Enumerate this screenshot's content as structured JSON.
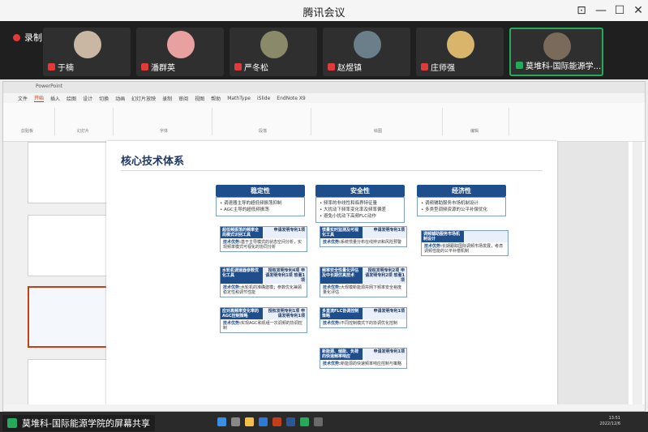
{
  "window": {
    "title": "腾讯会议"
  },
  "recording": {
    "label": "录制中"
  },
  "participants": [
    {
      "name": "于楠",
      "avatar_color": "#c9b7a3"
    },
    {
      "name": "潘群英",
      "avatar_color": "#e8a0a0"
    },
    {
      "name": "严冬松",
      "avatar_color": "#8a8a6a"
    },
    {
      "name": "赵煜镇",
      "avatar_color": "#6a7f8a"
    },
    {
      "name": "庄师强",
      "avatar_color": "#d8b56a"
    },
    {
      "name": "莫堆科-国际能源学...",
      "avatar_color": "#7a6a5a"
    }
  ],
  "ppt": {
    "tabs": [
      "文件",
      "开始",
      "插入",
      "绘图",
      "设计",
      "切换",
      "动画",
      "幻灯片放映",
      "录制",
      "审阅",
      "视图",
      "帮助",
      "MathType",
      "iSlide",
      "EndNote X9"
    ],
    "active_tab": "开始",
    "ribbon_groups": [
      "剪贴板",
      "幻灯片",
      "字体",
      "段落",
      "绘图",
      "编辑"
    ]
  },
  "slide": {
    "title": "核心技术体系",
    "columns": [
      {
        "head": "稳定性",
        "body": [
          "• 调速器主导的超低频振荡抑制",
          "• AGC主导的超低频振荡"
        ]
      },
      {
        "head": "安全性",
        "body": [
          "• 频率的非线性和临界特征量",
          "• 大扰动下频率变化率及频率偏差",
          "• 避免小扰动下高频FLC动作"
        ]
      },
      {
        "head": "经济性",
        "body": [
          "• 调频辅助服务市场机制设计",
          "• 多类型调频资源的公平补偿优化"
        ]
      }
    ],
    "cards": [
      {
        "title": "超低频振荡的频率全局模式识别工具",
        "patent": "申请发明专利1项",
        "label": "技术优势:",
        "text": "基于主导模式的状态空间分析，实现频率模式可视化的协同分析"
      },
      {
        "title": "水轮机调速器参数优化工具",
        "patent": "授权发明专利4项 申请发明专利1项 软著1项",
        "label": "技术优势:",
        "text": "水轮机的准确建模；参数优化兼顾稳定性和调节性能"
      },
      {
        "title": "应对高频率变化率的AGC控制策略",
        "patent": "授权发明专利1项 申请发明专利1项",
        "label": "技术优势:",
        "text": "实现AGC和机组一次调频的协调控制"
      },
      {
        "title": "惯量实时监测及可视化工具",
        "patent": "申请发明专利1项",
        "label": "技术优势:",
        "text": "系统惯量分布在线辨识和风险预警"
      },
      {
        "title": "频率安全性量化评估及中长期仿真技术",
        "patent": "授权发明专利2项 申请发明专利2项 软著1项",
        "label": "技术优势:",
        "text": "大规模新能源并网下频率安全裕度量化评估"
      },
      {
        "title": "多直流FLC协调控制策略",
        "patent": "申请发明专利1项",
        "label": "技术优势:",
        "text": "不同控制模式下的协调优化控制"
      },
      {
        "title": "新能源、储能、负荷的快速频率响应",
        "patent": "申请发明专利1项",
        "label": "技术优势:",
        "text": "新能源的快速频率响应控制与策略"
      },
      {
        "title": "调频辅助服务市场机制设计",
        "patent": "",
        "label": "技术优势:",
        "text": "长期跟踪国际调频市场发展，考虑调频性能的公平补偿机制"
      }
    ]
  },
  "sharing": {
    "banner": "莫堆科-国际能源学院的屏幕共享"
  },
  "clock": {
    "time": "13:51",
    "date": "2022/12/6"
  }
}
